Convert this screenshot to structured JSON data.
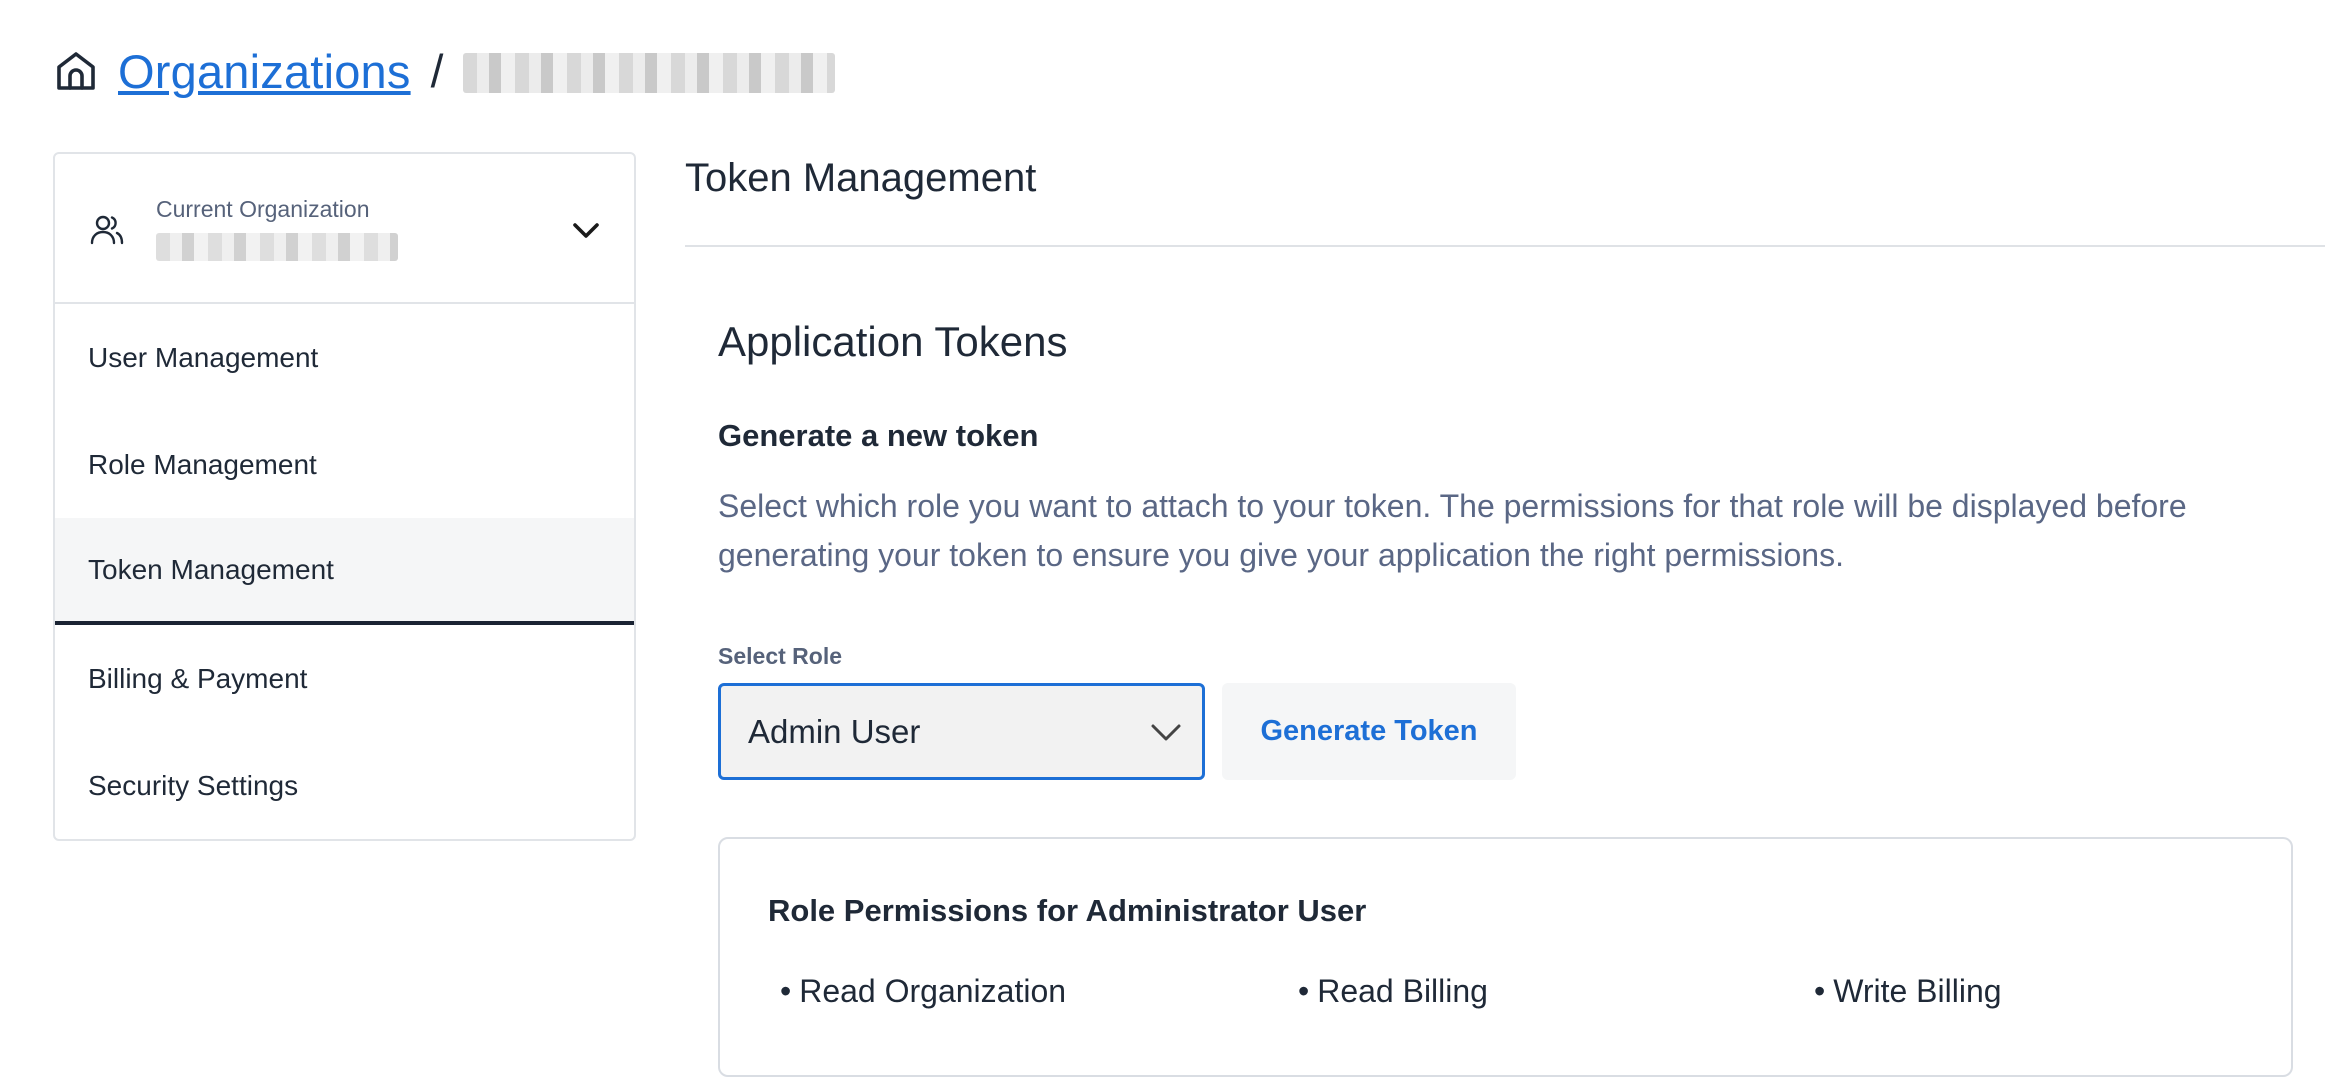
{
  "breadcrumb": {
    "link_label": "Organizations",
    "separator": "/"
  },
  "sidebar": {
    "org_label": "Current Organization",
    "items": [
      {
        "label": "User Management"
      },
      {
        "label": "Role Management"
      },
      {
        "label": "Token Management",
        "active": true
      },
      {
        "label": "Billing & Payment"
      },
      {
        "label": "Security Settings"
      }
    ]
  },
  "main": {
    "title": "Token Management",
    "section_title": "Application Tokens",
    "subtitle": "Generate a new token",
    "description": "Select which role you want to attach to your token. The permissions for that role will be displayed before generating your token to ensure you give your application the right permissions.",
    "select_label": "Select Role",
    "selected_role": "Admin User",
    "generate_button": "Generate Token",
    "permissions_title": "Role Permissions for Administrator User",
    "permissions": [
      "Read Organization",
      "Read Billing",
      "Write Billing"
    ]
  },
  "colors": {
    "link": "#1d6fd6",
    "text_primary": "#1f2937",
    "text_muted": "#5a6785",
    "border": "#e1e4e8",
    "active_underline": "#1a2333"
  },
  "icons": [
    "home-icon",
    "users-icon",
    "chevron-down-icon",
    "select-chevron-icon"
  ]
}
